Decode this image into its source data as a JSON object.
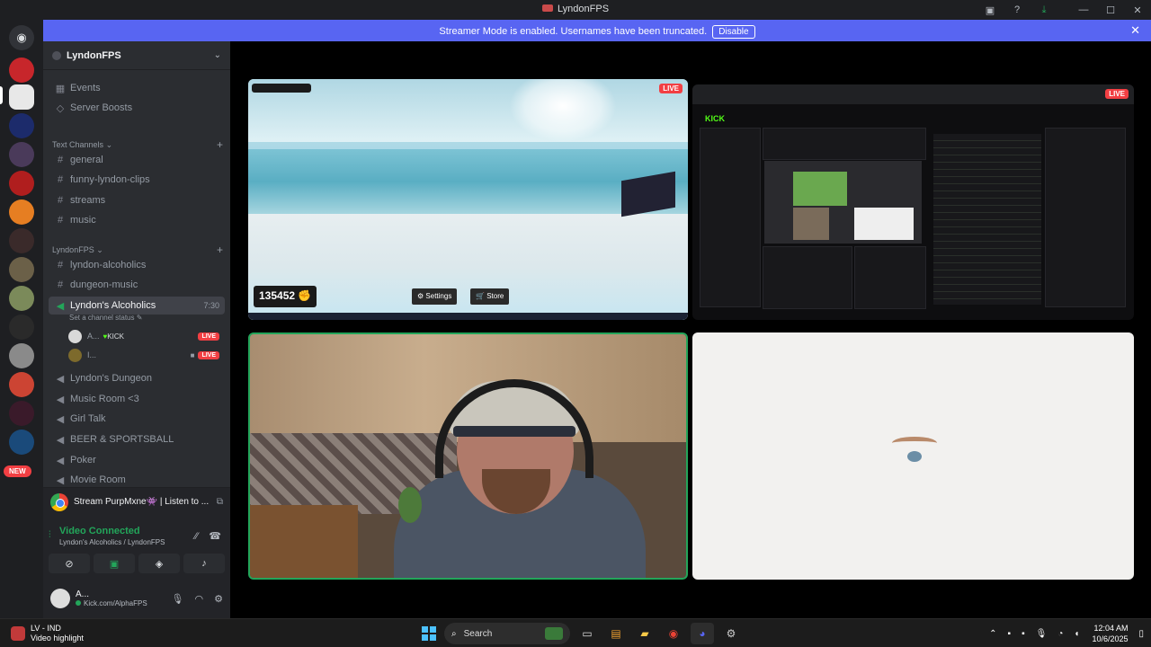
{
  "window": {
    "title": "LyndonFPS"
  },
  "banner": {
    "message": "Streamer Mode is enabled. Usernames have been truncated.",
    "disable_label": "Disable"
  },
  "rail": {
    "new_badge": "NEW"
  },
  "guild": {
    "name": "LyndonFPS",
    "events": "Events",
    "boosts": "Server Boosts"
  },
  "categories": {
    "text": "Text Channels",
    "lyndonfps": "LyndonFPS"
  },
  "channels": {
    "text": [
      "general",
      "funny-lyndon-clips",
      "streams",
      "music"
    ],
    "lyndonfps_text": [
      "lyndon-alcoholics",
      "dungeon-music"
    ],
    "active_voice": {
      "name": "Lyndon's Alcoholics",
      "time": "7:30",
      "status": "Set a channel status"
    },
    "voice_users": [
      {
        "name": "A...",
        "tag": "KICK",
        "badge": "LIVE"
      },
      {
        "name": "I...",
        "badge": "LIVE"
      }
    ],
    "voice": [
      "Lyndon's Dungeon",
      "Music Room <3",
      "Girl Talk",
      "BEER & SPORTSBALL",
      "Poker",
      "Movie Room"
    ]
  },
  "activity": {
    "text": "Stream PurpMxne👾 | Listen to ..."
  },
  "voice_panel": {
    "status": "Video Connected",
    "location": "Lyndon's Alcoholics / LyndonFPS"
  },
  "user": {
    "name": "A...",
    "status": "Kick.com/AlphaFPS"
  },
  "stage": {
    "live_label": "LIVE",
    "game": {
      "score": "135452",
      "settings": "Settings",
      "store": "Store"
    },
    "dashboard": {
      "logo": "KICK"
    }
  },
  "taskbar": {
    "weather_title": "LV - IND",
    "weather_sub": "Video highlight",
    "search_placeholder": "Search",
    "time": "12:04 AM",
    "date": "10/6/2025"
  }
}
